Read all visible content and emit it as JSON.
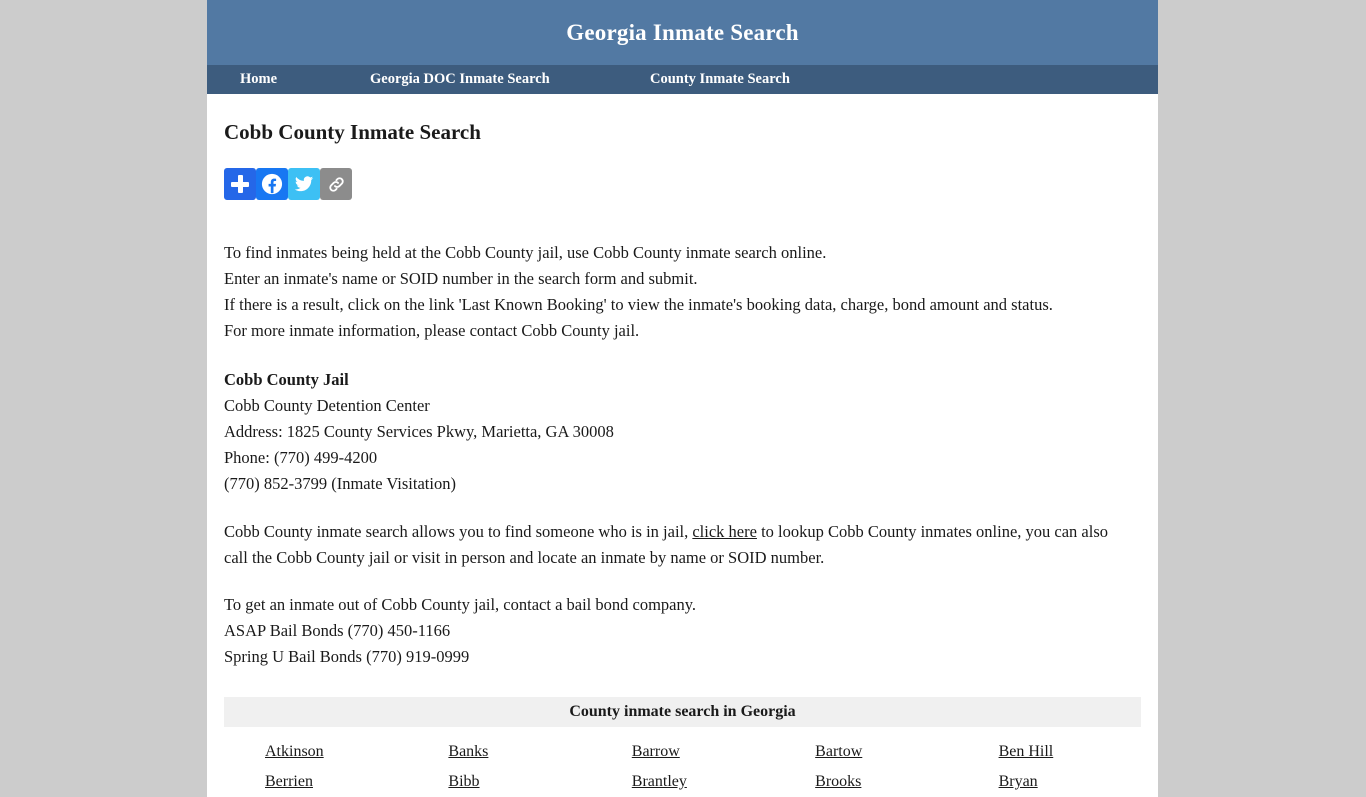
{
  "site": {
    "title": "Georgia Inmate Search",
    "header_color": "#5279a3",
    "nav_color": "#3d5c7e",
    "page_background": "#cccccc"
  },
  "nav": {
    "items": [
      {
        "label": "Home"
      },
      {
        "label": "Georgia DOC Inmate Search"
      },
      {
        "label": "County Inmate Search"
      }
    ]
  },
  "main": {
    "page_title": "Cobb County Inmate Search",
    "share": {
      "buttons": [
        {
          "icon": "share-plus-icon",
          "label": "Share",
          "color": "#2567e8"
        },
        {
          "icon": "facebook-icon",
          "label": "Facebook",
          "color": "#1877f2"
        },
        {
          "icon": "twitter-icon",
          "label": "Twitter",
          "color": "#3dc0f4"
        },
        {
          "icon": "copy-link-icon",
          "label": "Copy Link",
          "color": "#8c8c8c"
        }
      ]
    },
    "intro_lines": [
      "To find inmates being held at the Cobb County jail, use Cobb County inmate search online.",
      "Enter an inmate's name or SOID number in the search form and submit.",
      "If there is a result, click on the link 'Last Known Booking' to view the inmate's booking data, charge, bond amount and status.",
      "For more inmate information, please contact Cobb County jail."
    ],
    "jail": {
      "name": "Cobb County Jail",
      "facility": "Cobb County Detention Center",
      "address": "Address: 1825 County Services Pkwy, Marietta, GA 30008",
      "phone": "Phone: (770) 499-4200",
      "visitation": "(770) 852-3799 (Inmate Visitation)"
    },
    "search_paragraph": {
      "before_link": "Cobb County inmate search allows you to find someone who is in jail, ",
      "link_text": "click here",
      "after_link": " to lookup Cobb County inmates online, you can also call the Cobb County jail or visit in person and locate an inmate by name or SOID number."
    },
    "bail": {
      "intro": "To get an inmate out of Cobb County jail, contact a bail bond company.",
      "companies": [
        "ASAP Bail Bonds (770) 450-1166",
        "Spring U Bail Bonds (770) 919-0999"
      ]
    },
    "county_table": {
      "caption": "County inmate search in Georgia",
      "rows": [
        [
          "Atkinson",
          "Banks",
          "Barrow",
          "Bartow",
          "Ben Hill"
        ],
        [
          "Berrien",
          "Bibb",
          "Brantley",
          "Brooks",
          "Bryan"
        ]
      ]
    }
  }
}
